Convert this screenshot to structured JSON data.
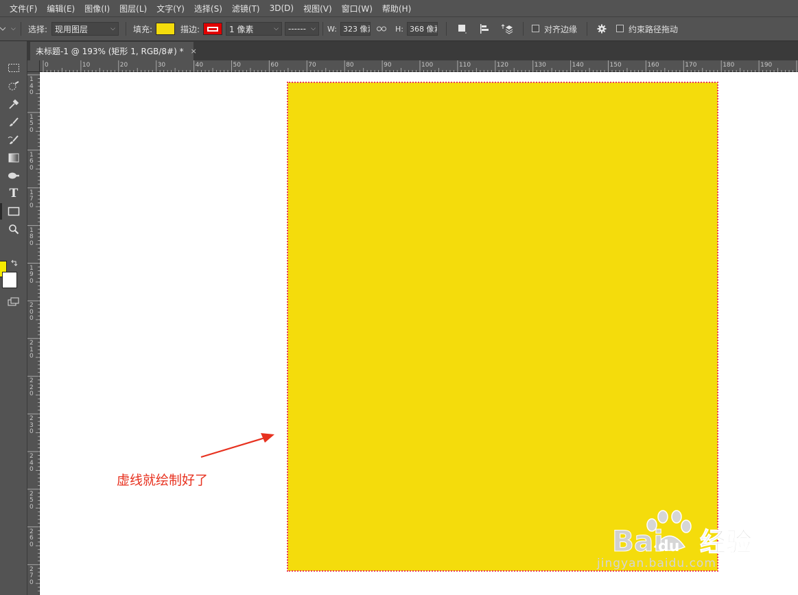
{
  "menu": [
    "文件(F)",
    "编辑(E)",
    "图像(I)",
    "图层(L)",
    "文字(Y)",
    "选择(S)",
    "滤镜(T)",
    "3D(D)",
    "视图(V)",
    "窗口(W)",
    "帮助(H)"
  ],
  "options": {
    "select_label": "选择:",
    "select_value": "现用图层",
    "fill_label": "填充:",
    "fill_color": "#f4dc0c",
    "stroke_label": "描边:",
    "stroke_color": "#e00000",
    "stroke_width": "1 像素",
    "stroke_style": "------",
    "w_label": "W:",
    "w_value": "323 像素",
    "link_icon": "link-icon",
    "h_label": "H:",
    "h_value": "368 像素",
    "align_edges_label": "对齐边缘",
    "constrain_label": "约束路径拖动"
  },
  "document": {
    "tab_title": "未标题-1 @ 193% (矩形 1, RGB/8#) *",
    "close": "×"
  },
  "ruler": {
    "h_ticks": [
      "0",
      "10",
      "20",
      "30",
      "40",
      "50",
      "60",
      "70",
      "80",
      "90",
      "100",
      "110",
      "120",
      "130",
      "140",
      "150",
      "160",
      "170",
      "180",
      "190"
    ],
    "v_ticks": [
      "140",
      "150",
      "160",
      "170",
      "180",
      "190",
      "200",
      "210",
      "220",
      "230",
      "240",
      "250",
      "260",
      "270"
    ]
  },
  "toolbar": {
    "icons": [
      "rect-marquee-icon",
      "quick-select-icon",
      "eyedropper-icon",
      "brush-icon",
      "history-brush-icon",
      "gradient-icon",
      "smudge-icon",
      "type-icon",
      "rectangle-tool-icon",
      "zoom-icon"
    ],
    "fg_color": "#f5eb00",
    "bg_color": "#ffffff"
  },
  "canvas": {
    "shape_fill": "#f4dc0c",
    "shape_stroke": "#e8375c",
    "annotation": "虚线就绘制好了",
    "annotation_color": "#e7311f"
  },
  "watermark": {
    "logo_text": "Bai du 经验",
    "url": "jingyan.baidu.com"
  }
}
